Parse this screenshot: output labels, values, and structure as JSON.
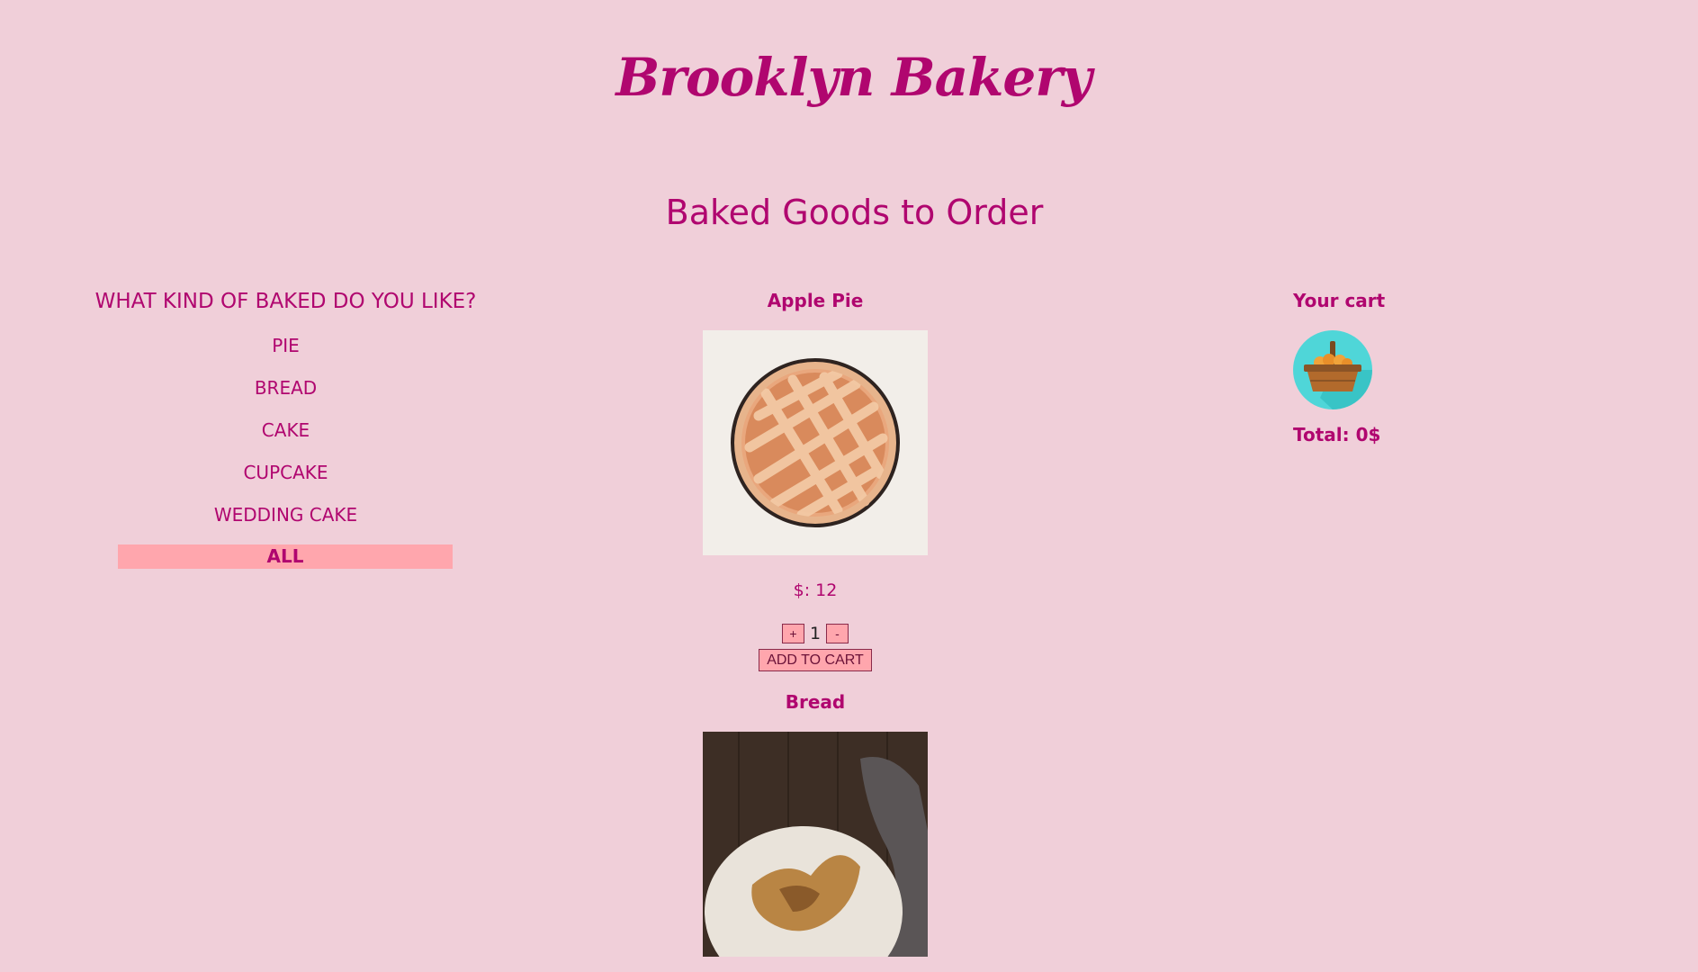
{
  "header": {
    "logo_text": "Brooklyn Bakery",
    "page_title": "Baked Goods to Order"
  },
  "sidebar": {
    "heading": "WHAT KIND OF BAKED DO YOU LIKE?",
    "categories": [
      {
        "label": "PIE",
        "active": false
      },
      {
        "label": "BREAD",
        "active": false
      },
      {
        "label": "CAKE",
        "active": false
      },
      {
        "label": "CUPCAKE",
        "active": false
      },
      {
        "label": "WEDDING CAKE",
        "active": false
      },
      {
        "label": "ALL",
        "active": true
      }
    ]
  },
  "products": [
    {
      "name": "Apple Pie",
      "price": "$: 12",
      "quantity": "1",
      "plus_label": "+",
      "minus_label": "-",
      "add_label": "ADD TO CART",
      "image_icon": "apple-pie-image"
    },
    {
      "name": "Bread",
      "image_icon": "bread-image"
    }
  ],
  "cart": {
    "title": "Your cart",
    "icon": "basket-icon",
    "total": "Total: 0$"
  },
  "colors": {
    "background": "#f0cfd9",
    "brand": "#b0066f",
    "button": "#ffa6ad",
    "cart_circle": "#4fd6d8"
  }
}
